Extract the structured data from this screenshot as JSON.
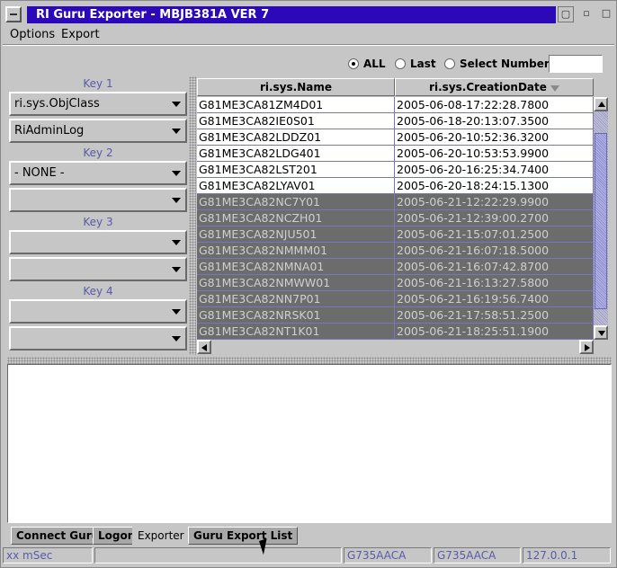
{
  "window": {
    "title": "RI Guru Exporter - MBJB381A  VER 7"
  },
  "menubar": {
    "items": [
      "Options",
      "Export"
    ]
  },
  "filter": {
    "options": [
      "ALL",
      "Last",
      "Select Number"
    ],
    "selected": "ALL",
    "number_value": ""
  },
  "keys": {
    "groups": [
      {
        "label": "Key 1",
        "values": [
          "ri.sys.ObjClass",
          "RiAdminLog"
        ]
      },
      {
        "label": "Key 2",
        "values": [
          "- NONE -",
          ""
        ]
      },
      {
        "label": "Key 3",
        "values": [
          "",
          ""
        ]
      },
      {
        "label": "Key 4",
        "values": [
          "",
          ""
        ]
      }
    ]
  },
  "table": {
    "columns": [
      "ri.sys.Name",
      "ri.sys.CreationDate"
    ],
    "sort_column": "ri.sys.CreationDate",
    "sort_direction": "descending",
    "rows": [
      {
        "name": "G81ME3CA81ZM4D01",
        "date": "2005-06-08-17:22:28.7800",
        "selected": false
      },
      {
        "name": "G81ME3CA82IE0S01",
        "date": "2005-06-18-20:13:07.3500",
        "selected": false
      },
      {
        "name": "G81ME3CA82LDDZ01",
        "date": "2005-06-20-10:52:36.3200",
        "selected": false
      },
      {
        "name": "G81ME3CA82LDG401",
        "date": "2005-06-20-10:53:53.9900",
        "selected": false
      },
      {
        "name": "G81ME3CA82LST201",
        "date": "2005-06-20-16:25:34.7400",
        "selected": false
      },
      {
        "name": "G81ME3CA82LYAV01",
        "date": "2005-06-20-18:24:15.1300",
        "selected": false
      },
      {
        "name": "G81ME3CA82NC7Y01",
        "date": "2005-06-21-12:22:29.9900",
        "selected": true
      },
      {
        "name": "G81ME3CA82NCZH01",
        "date": "2005-06-21-12:39:00.2700",
        "selected": true
      },
      {
        "name": "G81ME3CA82NJU501",
        "date": "2005-06-21-15:07:01.2500",
        "selected": true
      },
      {
        "name": "G81ME3CA82NMMM01",
        "date": "2005-06-21-16:07:18.5000",
        "selected": true
      },
      {
        "name": "G81ME3CA82NMNA01",
        "date": "2005-06-21-16:07:42.8700",
        "selected": true
      },
      {
        "name": "G81ME3CA82NMWW01",
        "date": "2005-06-21-16:13:27.5800",
        "selected": true
      },
      {
        "name": "G81ME3CA82NN7P01",
        "date": "2005-06-21-16:19:56.7400",
        "selected": true
      },
      {
        "name": "G81ME3CA82NRSK01",
        "date": "2005-06-21-17:58:51.2500",
        "selected": true
      },
      {
        "name": "G81ME3CA82NT1K01",
        "date": "2005-06-21-18:25:51.1900",
        "selected": true
      }
    ]
  },
  "tabs": {
    "items": [
      "Connect Guru",
      "Logon",
      "Exporter",
      "Guru Export List"
    ],
    "active": "Exporter"
  },
  "statusbar": {
    "fields": [
      "xx mSec",
      "",
      "G735AACA",
      "G735AACA",
      "127.0.0.1"
    ]
  },
  "colors": {
    "title_bar": "#2b08b8",
    "window_bg": "#c6c6c6",
    "selected_row": "#6c6c6c",
    "accent_text": "#5a5aa8"
  }
}
